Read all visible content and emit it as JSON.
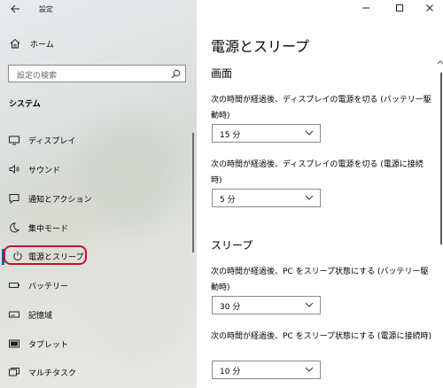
{
  "window": {
    "title": "設定",
    "minimize_icon": "minimize-icon",
    "maximize_icon": "maximize-icon",
    "close_icon": "close-icon"
  },
  "sidebar": {
    "home_label": "ホーム",
    "search_placeholder": "設定の検索",
    "section_heading": "システム",
    "items": [
      {
        "label": "ディスプレイ",
        "icon": "display-icon"
      },
      {
        "label": "サウンド",
        "icon": "speaker-icon"
      },
      {
        "label": "通知とアクション",
        "icon": "notification-icon"
      },
      {
        "label": "集中モード",
        "icon": "moon-icon"
      },
      {
        "label": "電源とスリープ",
        "icon": "power-icon",
        "selected": true
      },
      {
        "label": "バッテリー",
        "icon": "battery-icon"
      },
      {
        "label": "記憶域",
        "icon": "storage-icon"
      },
      {
        "label": "タブレット",
        "icon": "tablet-icon"
      },
      {
        "label": "マルチタスク",
        "icon": "multitask-icon"
      }
    ]
  },
  "main": {
    "title": "電源とスリープ",
    "screen": {
      "heading": "画面",
      "battery_desc": "次の時間が経過後、ディスプレイの電源を切る (バッテリー駆動時)",
      "battery_value": "15 分",
      "plugged_desc": "次の時間が経過後、ディスプレイの電源を切る (電源に接続時)",
      "plugged_value": "5 分"
    },
    "sleep": {
      "heading": "スリープ",
      "battery_desc": "次の時間が経過後、PC をスリープ状態にする (バッテリー駆動時)",
      "battery_value": "30 分",
      "plugged_desc": "次の時間が経過後、PC をスリープ状態にする (電源に接続時)",
      "plugged_value": "10 分"
    }
  },
  "colors": {
    "accent": "#0063b1",
    "highlight": "#c8102e"
  }
}
